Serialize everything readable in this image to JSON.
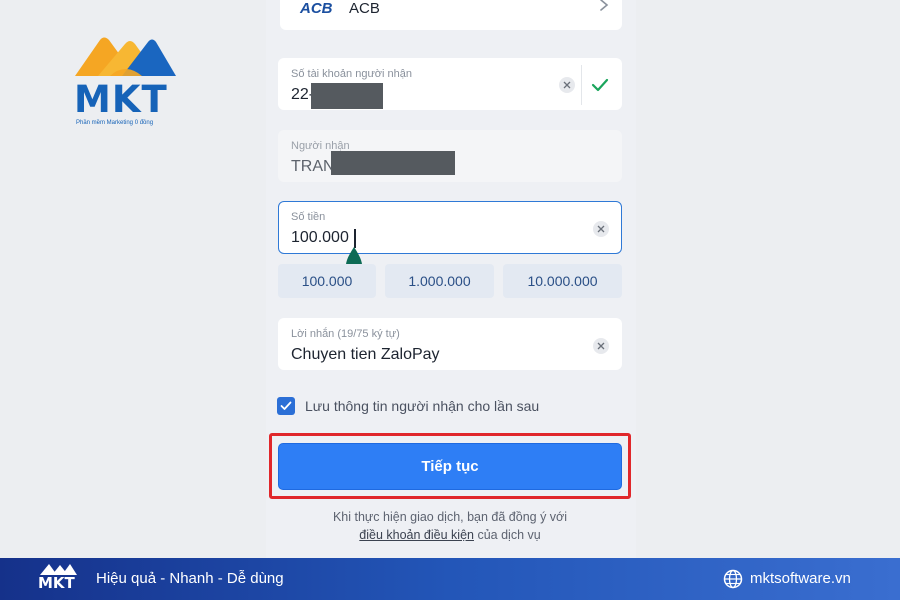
{
  "brand": {
    "logo_text": "MKT",
    "tagline": "Phần mềm Marketing 0 đồng",
    "colors": {
      "primary": "#1663b8",
      "accent": "#f5a623"
    }
  },
  "bank": {
    "logo": "ACB",
    "name": "ACB"
  },
  "account_field": {
    "label": "Số tài khoản người nhận",
    "value": "22-"
  },
  "recipient_field": {
    "label": "Người nhận",
    "value": "TRAN"
  },
  "amount_field": {
    "label": "Số tiền",
    "value": "100.000"
  },
  "amount_chips": [
    "100.000",
    "1.000.000",
    "10.000.000"
  ],
  "message_field": {
    "label": "Lời nhắn (19/75 ký tự)",
    "value": "Chuyen tien ZaloPay"
  },
  "save_recipient": {
    "label": "Lưu thông tin người nhận cho lần sau",
    "checked": true
  },
  "continue_button": {
    "label": "Tiếp tục",
    "color": "#2e7ef5"
  },
  "terms": {
    "prefix": "Khi thực hiện giao dịch, bạn đã đồng ý với",
    "link": "điều khoản điều kiện",
    "suffix": " của dịch vụ"
  },
  "footer": {
    "logo_text": "MKT",
    "slogan": "Hiệu quả - Nhanh - Dễ dùng",
    "website": "mktsoftware.vn"
  },
  "highlight_color": "#e0272b"
}
